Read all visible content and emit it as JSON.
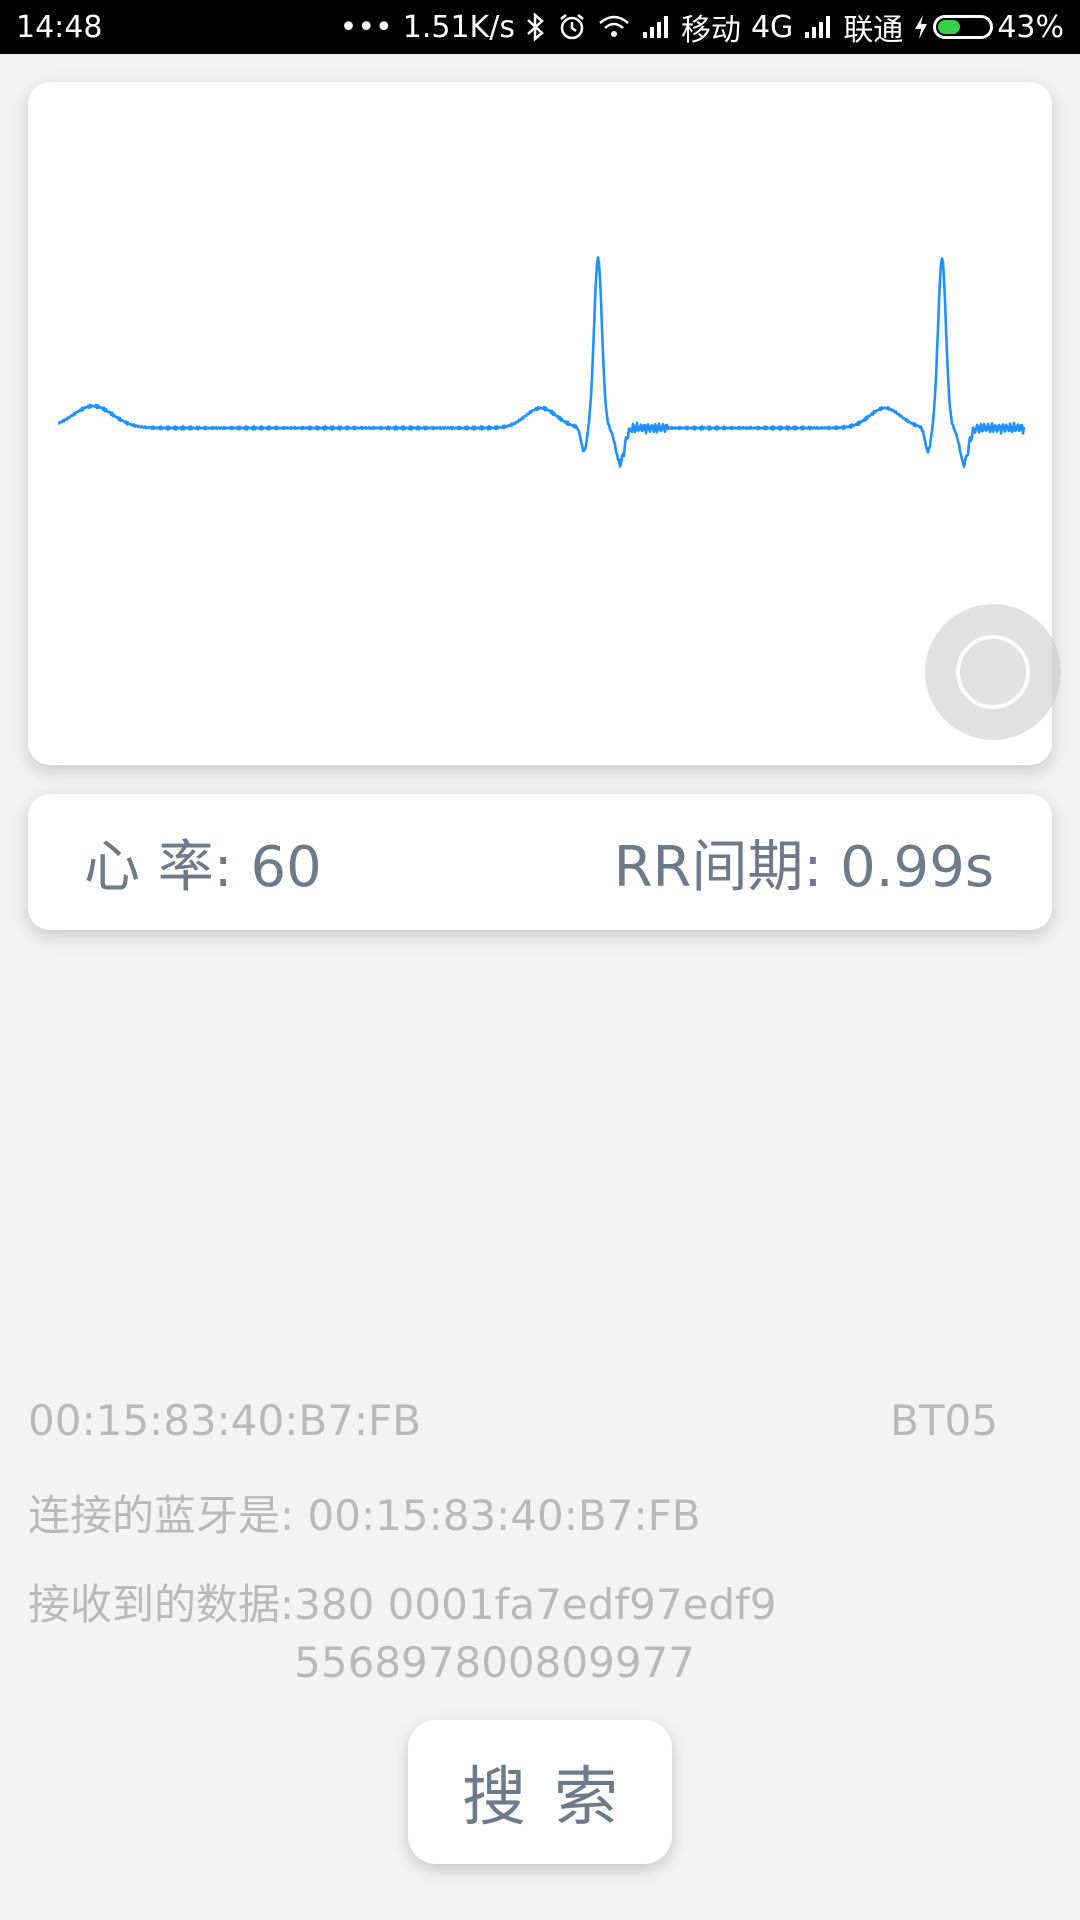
{
  "status_bar": {
    "time": "14:48",
    "dots": "•••",
    "speed": "1.51K/s",
    "carrier1": "移动",
    "network1": "4G",
    "carrier2": "联通",
    "battery_percent": "43%",
    "battery_level": 0.43,
    "battery_color": "#36d04a",
    "icons": [
      "bluetooth-icon",
      "alarm-icon",
      "wifi-icon",
      "signal-icon",
      "signal-icon",
      "charging-icon",
      "battery-icon"
    ]
  },
  "ecg": {
    "line_color": "#1e90ff"
  },
  "stats": {
    "heart_rate": "心 率: 60",
    "rr_interval": "RR间期: 0.99s"
  },
  "device": {
    "mac": "00:15:83:40:B7:FB",
    "name": "BT05",
    "connected_label": "连接的蓝牙是:",
    "connected_mac": "00:15:83:40:B7:FB",
    "data_label": "接收到的数据:",
    "data_line1": "380 0001fa7edf97edf9",
    "data_line2": "556897800809977"
  },
  "search_button": {
    "label": "搜索"
  }
}
